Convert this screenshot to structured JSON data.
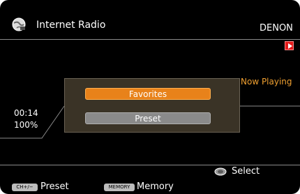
{
  "header": {
    "app_title": "Internet Radio",
    "brand": "DENON",
    "icon": "globe-icon"
  },
  "status": {
    "now_playing": "Now Playing",
    "time": "00:14",
    "volume": "100%",
    "play_icon": "play-icon"
  },
  "popup": {
    "items": [
      {
        "label": "Favorites",
        "selected": true
      },
      {
        "label": "Preset",
        "selected": false
      }
    ]
  },
  "footer": {
    "select_label": "Select",
    "select_icon": "dial-icon",
    "ch_key": "CH+/−",
    "preset_label": "Preset",
    "memory_key": "MEMORY",
    "memory_label": "Memory"
  },
  "colors": {
    "background": "#000000",
    "accent": "#e8821a",
    "now_playing": "#f0a030",
    "popup_bg": "#3a3326",
    "play_red": "#e31b1b"
  }
}
